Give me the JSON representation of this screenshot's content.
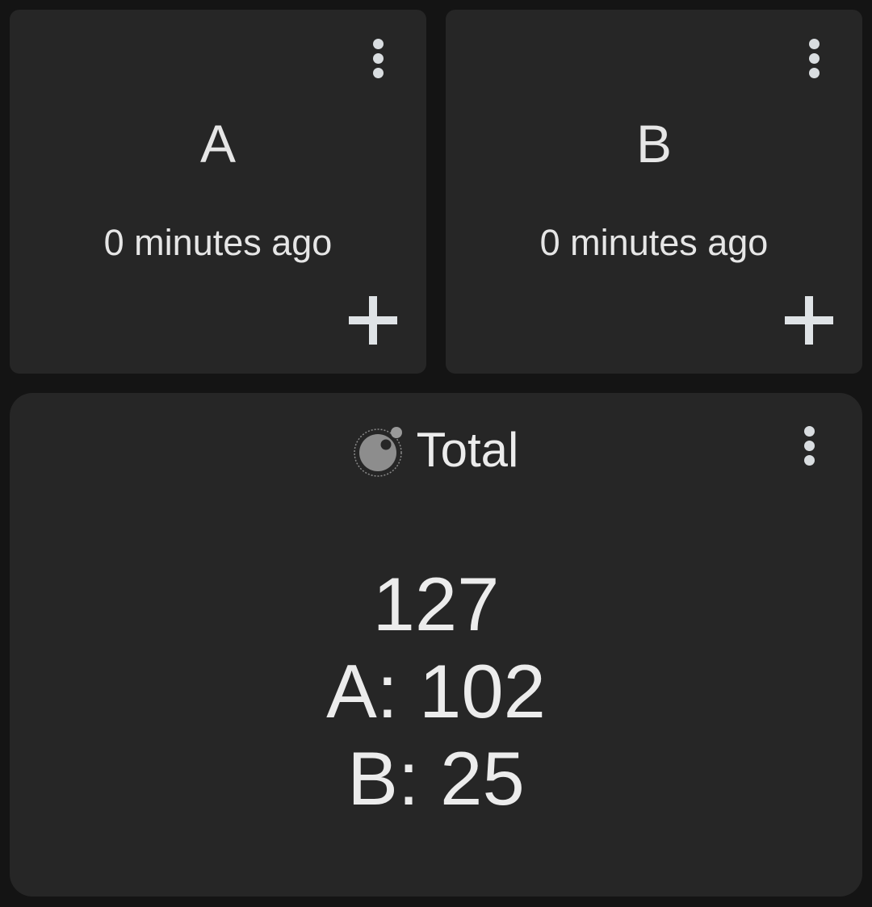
{
  "counters": [
    {
      "name": "A",
      "updated": "0 minutes ago"
    },
    {
      "name": "B",
      "updated": "0 minutes ago"
    }
  ],
  "total": {
    "title": "Total",
    "icon": "app-logo-icon",
    "lines": [
      "127",
      "A: 102",
      "B: 25"
    ]
  },
  "icons": {
    "menu": "more-vert-icon",
    "add": "plus-icon"
  },
  "colors": {
    "background": "#141414",
    "card": "#262626",
    "text": "#e6e6e6",
    "icon": "#d9dde0"
  }
}
